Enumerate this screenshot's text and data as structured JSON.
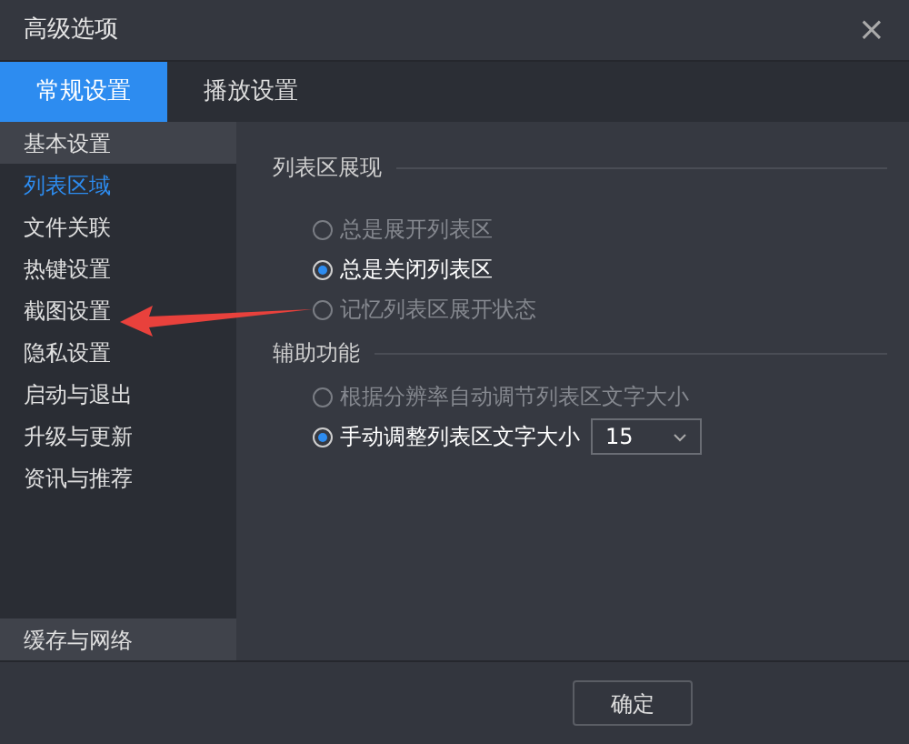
{
  "window": {
    "title": "高级选项",
    "close": "×"
  },
  "tabs": [
    {
      "label": "常规设置",
      "selected": true
    },
    {
      "label": "播放设置",
      "selected": false
    }
  ],
  "sidebar": {
    "items": [
      {
        "label": "基本设置",
        "selected": false,
        "highlighted": true
      },
      {
        "label": "列表区域",
        "selected": true,
        "highlighted": false
      },
      {
        "label": "文件关联",
        "selected": false,
        "highlighted": false
      },
      {
        "label": "热键设置",
        "selected": false,
        "highlighted": false
      },
      {
        "label": "截图设置",
        "selected": false,
        "highlighted": false
      },
      {
        "label": "隐私设置",
        "selected": false,
        "highlighted": false
      },
      {
        "label": "启动与退出",
        "selected": false,
        "highlighted": false
      },
      {
        "label": "升级与更新",
        "selected": false,
        "highlighted": false
      },
      {
        "label": "资讯与推荐",
        "selected": false,
        "highlighted": false
      }
    ],
    "bottom_item": {
      "label": "缓存与网络",
      "selected": false,
      "highlighted": true
    }
  },
  "sections": [
    {
      "title": "列表区展现",
      "options": [
        {
          "label": "总是展开列表区",
          "selected": false
        },
        {
          "label": "总是关闭列表区",
          "selected": true
        },
        {
          "label": "记忆列表区展开状态",
          "selected": false
        }
      ]
    },
    {
      "title": "辅助功能",
      "options": [
        {
          "label": "根据分辨率自动调节列表区文字大小",
          "selected": false
        },
        {
          "label": "手动调整列表区文字大小",
          "selected": true,
          "dropdown": "15"
        }
      ]
    }
  ],
  "buttons": [
    "确定"
  ]
}
